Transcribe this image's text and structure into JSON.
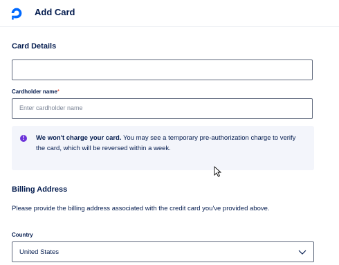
{
  "header": {
    "title": "Add Card",
    "logo_icon": "digitalocean-logo-icon",
    "brand_color": "#0069ff"
  },
  "card_details": {
    "section_title": "Card Details",
    "card_number_placeholder": "",
    "cardholder_label": "Cardholder name",
    "cardholder_required_mark": "*",
    "cardholder_placeholder": "Enter cardholder name"
  },
  "notice": {
    "icon": "info-icon",
    "bold_text": "We won't charge your card.",
    "text": " You may see a temporary pre-authorization charge to verify the card, which will be reversed within a week."
  },
  "billing": {
    "section_title": "Billing Address",
    "description": "Please provide the billing address associated with the credit card you've provided above.",
    "country_label": "Country",
    "country_value": "United States",
    "chevron_icon": "chevron-down-icon"
  }
}
